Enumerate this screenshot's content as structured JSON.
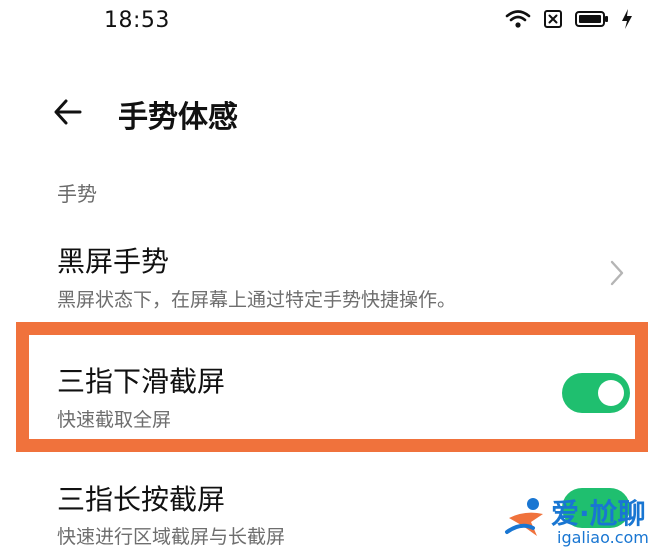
{
  "status_bar": {
    "time": "18:53",
    "icons": [
      "wifi-icon",
      "sim-icon",
      "battery-icon",
      "charging-icon"
    ]
  },
  "header": {
    "back_icon": "arrow-left-icon",
    "title": "手势体感"
  },
  "section": {
    "label": "手势"
  },
  "items": [
    {
      "title": "黑屏手势",
      "subtitle": "黑屏状态下，在屏幕上通过特定手势快捷操作。",
      "control": "chevron-right-icon"
    },
    {
      "title": "三指下滑截屏",
      "subtitle": "快速截取全屏",
      "control": "toggle",
      "enabled": true
    },
    {
      "title": "三指长按截屏",
      "subtitle": "快速进行区域截屏与长截屏",
      "control": "toggle",
      "enabled": true
    }
  ],
  "colors": {
    "toggle_on": "#1fbf6f",
    "highlight_border": "#f0723c",
    "watermark": "#1976d2"
  },
  "watermark": {
    "text": "爱·尬聊",
    "domain": "igaliao.com"
  }
}
